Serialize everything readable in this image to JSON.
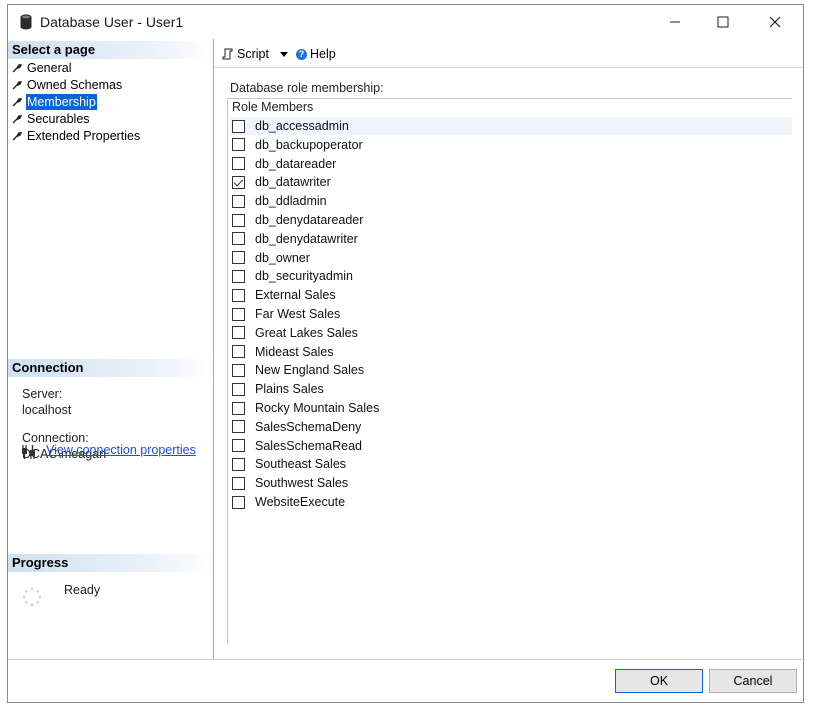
{
  "window": {
    "title": "Database User - User1"
  },
  "left": {
    "select_page_header": "Select a page",
    "pages": [
      {
        "label": "General",
        "selected": false
      },
      {
        "label": "Owned Schemas",
        "selected": false
      },
      {
        "label": "Membership",
        "selected": true
      },
      {
        "label": "Securables",
        "selected": false
      },
      {
        "label": "Extended Properties",
        "selected": false
      }
    ],
    "connection_header": "Connection",
    "server_label": "Server:",
    "server_value": "localhost",
    "connection_label": "Connection:",
    "connection_value": "DCAC\\meagan",
    "view_connection_link": "View connection properties",
    "progress_header": "Progress",
    "progress_status": "Ready"
  },
  "toolbar": {
    "script_label": "Script",
    "help_label": "Help"
  },
  "main": {
    "membership_label": "Database role membership:",
    "column_header": "Role Members",
    "roles": [
      {
        "name": "db_accessadmin",
        "checked": false
      },
      {
        "name": "db_backupoperator",
        "checked": false
      },
      {
        "name": "db_datareader",
        "checked": false
      },
      {
        "name": "db_datawriter",
        "checked": true
      },
      {
        "name": "db_ddladmin",
        "checked": false
      },
      {
        "name": "db_denydatareader",
        "checked": false
      },
      {
        "name": "db_denydatawriter",
        "checked": false
      },
      {
        "name": "db_owner",
        "checked": false
      },
      {
        "name": "db_securityadmin",
        "checked": false
      },
      {
        "name": "External Sales",
        "checked": false
      },
      {
        "name": "Far West Sales",
        "checked": false
      },
      {
        "name": "Great Lakes Sales",
        "checked": false
      },
      {
        "name": "Mideast Sales",
        "checked": false
      },
      {
        "name": "New England Sales",
        "checked": false
      },
      {
        "name": "Plains Sales",
        "checked": false
      },
      {
        "name": "Rocky Mountain Sales",
        "checked": false
      },
      {
        "name": "SalesSchemaDeny",
        "checked": false
      },
      {
        "name": "SalesSchemaRead",
        "checked": false
      },
      {
        "name": "Southeast Sales",
        "checked": false
      },
      {
        "name": "Southwest Sales",
        "checked": false
      },
      {
        "name": "WebsiteExecute",
        "checked": false
      }
    ]
  },
  "footer": {
    "ok_label": "OK",
    "cancel_label": "Cancel"
  },
  "colors": {
    "selection": "#0a64d6",
    "link": "#1a54c8",
    "section_header": "#cfe0f0"
  },
  "icons": [
    "database-icon",
    "minimize-icon",
    "maximize-icon",
    "close-icon",
    "wrench-icon",
    "script-icon",
    "help-icon",
    "connection-plug-icon",
    "progress-spinner-icon"
  ]
}
